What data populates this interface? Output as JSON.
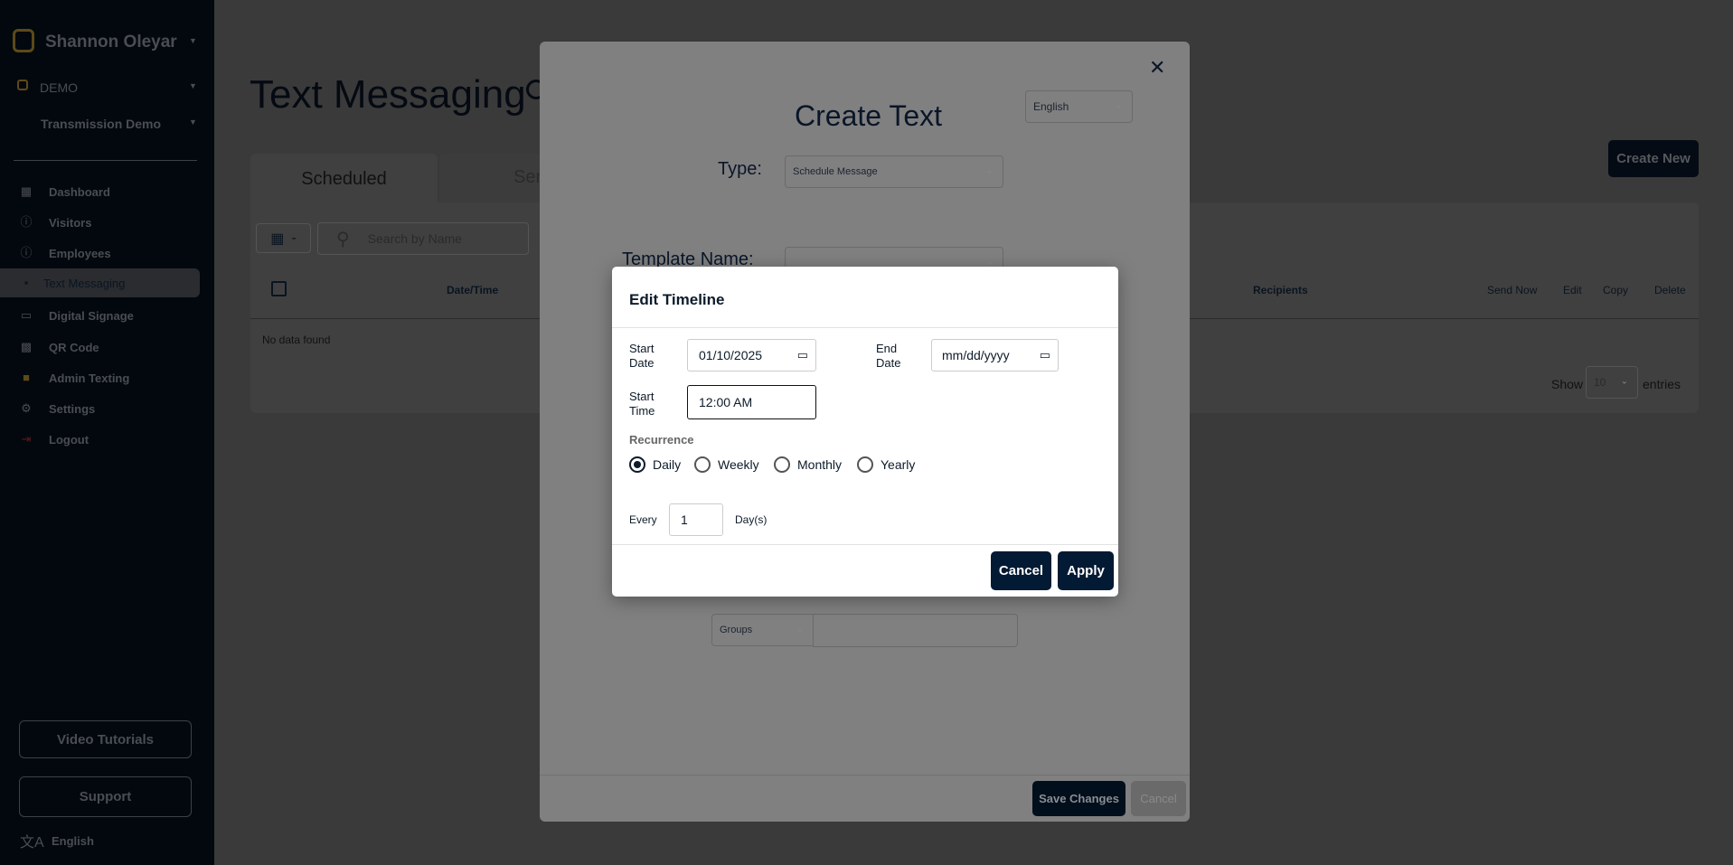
{
  "sidebar": {
    "user_name": "Shannon Oleyar",
    "org": "DEMO",
    "location": "Transmission Demo",
    "items": [
      {
        "label": "Dashboard",
        "icon": "dashboard-icon"
      },
      {
        "label": "Visitors",
        "icon": "info-icon"
      },
      {
        "label": "Employees",
        "icon": "info-icon"
      },
      {
        "label": "Text Messaging",
        "icon": "chat-icon",
        "active": true
      },
      {
        "label": "Digital Signage",
        "icon": "monitor-icon"
      },
      {
        "label": "QR Code",
        "icon": "qr-code-icon"
      },
      {
        "label": "Admin Texting",
        "icon": "chat-icon"
      },
      {
        "label": "Settings",
        "icon": "gear-icon"
      },
      {
        "label": "Logout",
        "icon": "logout-icon"
      }
    ],
    "video_tutorials": "Video Tutorials",
    "support": "Support",
    "language": "English",
    "accent_color": "#c9a227"
  },
  "page": {
    "title": "Text Messaging",
    "create_new": "Create New",
    "tabs": [
      "Scheduled",
      "Sen"
    ],
    "date_filter": "-",
    "search_placeholder": "Search by Name",
    "columns": [
      "Date/Time",
      "Recipients",
      "Send Now",
      "Edit",
      "Copy",
      "Delete"
    ],
    "empty": "No data found",
    "show": "Show",
    "entries_value": "10",
    "entries": "entries"
  },
  "create_modal": {
    "title": "Create Text",
    "language": "English",
    "type_label": "Type:",
    "type_value": "Schedule Message",
    "template_label": "Template Name:",
    "groups": "Groups",
    "save": "Save Changes",
    "cancel": "Cancel"
  },
  "timeline": {
    "title": "Edit Timeline",
    "start_date_label": "Start Date",
    "start_date": "01/10/2025",
    "end_date_label": "End Date",
    "end_date_placeholder": "mm/dd/yyyy",
    "start_time_label": "Start Time",
    "start_time": "12:00 AM",
    "recurrence_label": "Recurrence",
    "options": [
      "Daily",
      "Weekly",
      "Monthly",
      "Yearly"
    ],
    "selected": "Daily",
    "every": "Every",
    "every_value": "1",
    "unit": "Day(s)",
    "cancel": "Cancel",
    "apply": "Apply",
    "button_color": "#021a33"
  }
}
